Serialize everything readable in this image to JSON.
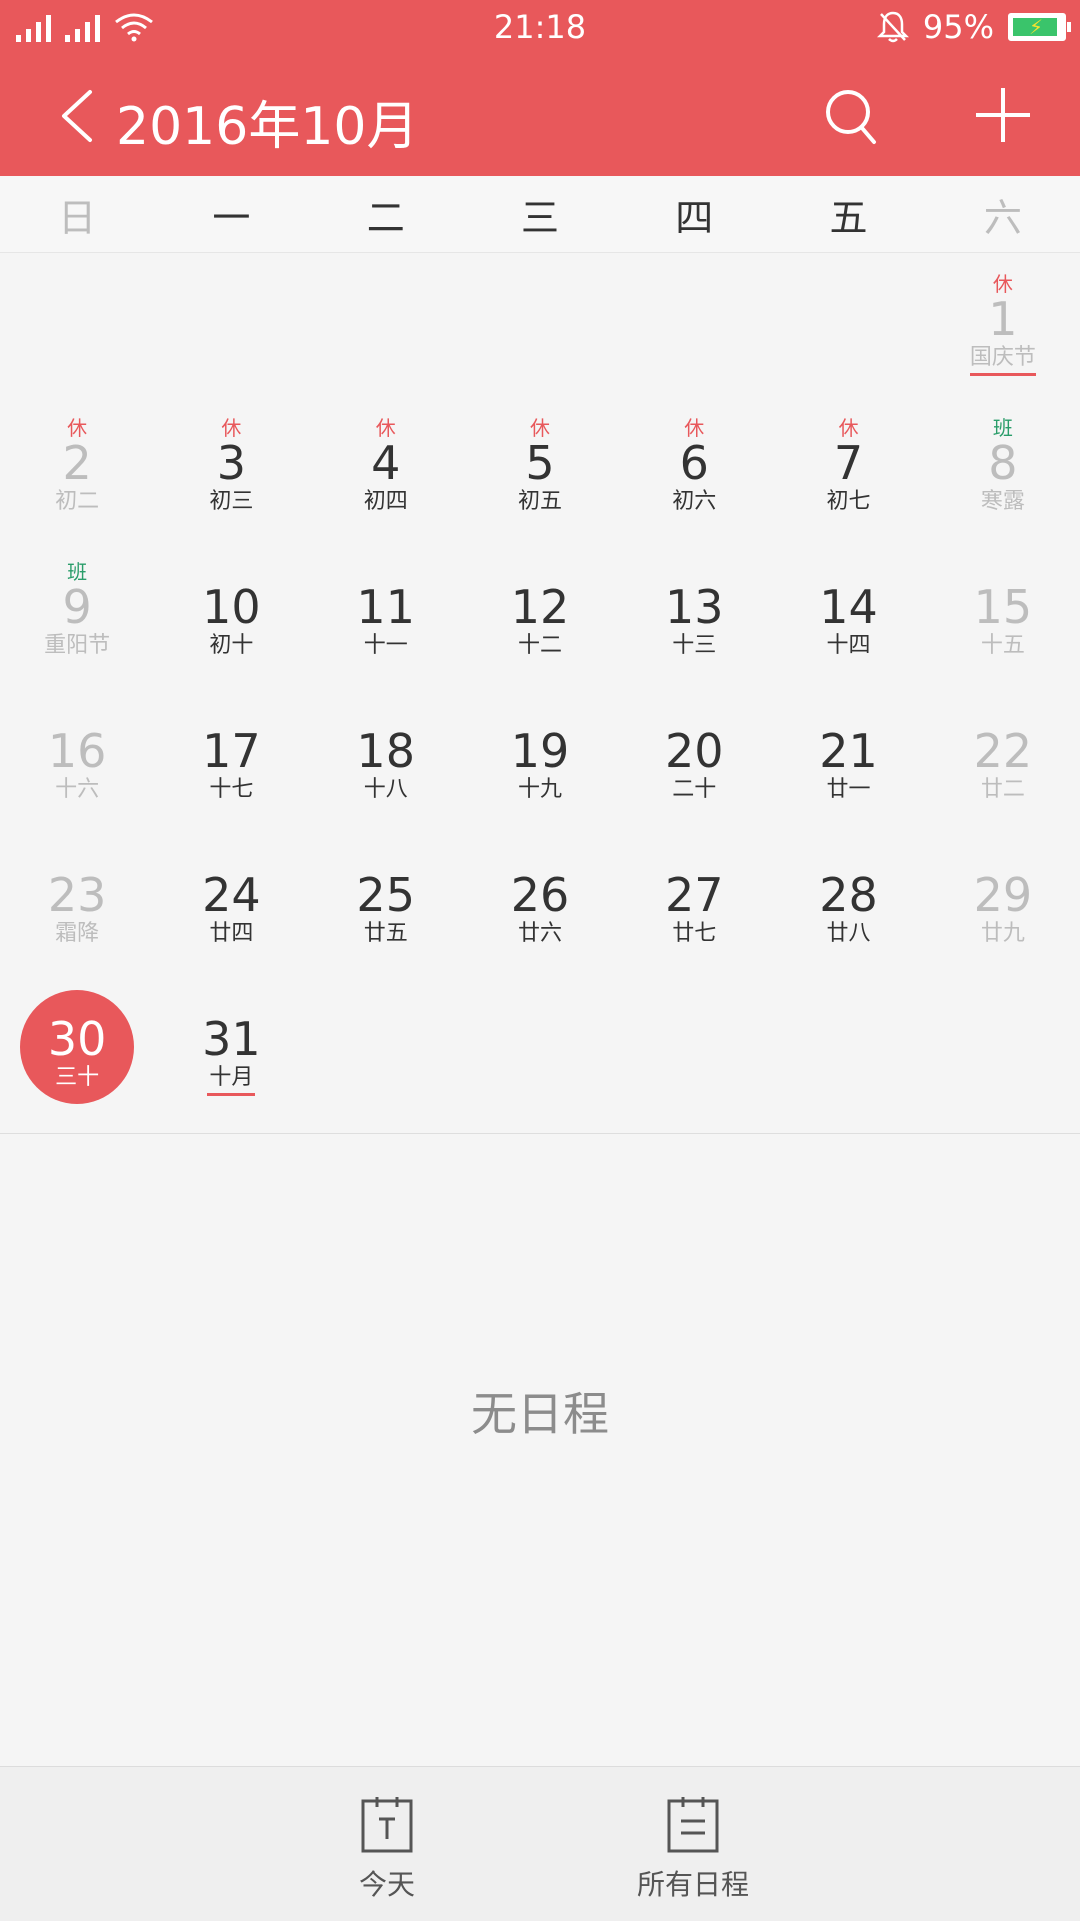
{
  "status_bar": {
    "time": "21:18",
    "battery": "95%",
    "icons": [
      "signal-icon",
      "signal-icon",
      "wifi-icon",
      "bell-off-icon",
      "battery-charging-icon"
    ]
  },
  "header": {
    "title": "2016年10月",
    "icons": [
      "back-icon",
      "search-icon",
      "add-icon"
    ]
  },
  "weekdays": [
    "日",
    "一",
    "二",
    "三",
    "四",
    "五",
    "六"
  ],
  "days": [
    {
      "num": "1",
      "lunar": "国庆节",
      "tag": "休"
    },
    {
      "num": "2",
      "lunar": "初二",
      "tag": "休"
    },
    {
      "num": "3",
      "lunar": "初三",
      "tag": "休"
    },
    {
      "num": "4",
      "lunar": "初四",
      "tag": "休"
    },
    {
      "num": "5",
      "lunar": "初五",
      "tag": "休"
    },
    {
      "num": "6",
      "lunar": "初六",
      "tag": "休"
    },
    {
      "num": "7",
      "lunar": "初七",
      "tag": "休"
    },
    {
      "num": "8",
      "lunar": "寒露",
      "tag": "班"
    },
    {
      "num": "9",
      "lunar": "重阳节",
      "tag": "班"
    },
    {
      "num": "10",
      "lunar": "初十"
    },
    {
      "num": "11",
      "lunar": "十一"
    },
    {
      "num": "12",
      "lunar": "十二"
    },
    {
      "num": "13",
      "lunar": "十三"
    },
    {
      "num": "14",
      "lunar": "十四"
    },
    {
      "num": "15",
      "lunar": "十五"
    },
    {
      "num": "16",
      "lunar": "十六"
    },
    {
      "num": "17",
      "lunar": "十七"
    },
    {
      "num": "18",
      "lunar": "十八"
    },
    {
      "num": "19",
      "lunar": "十九"
    },
    {
      "num": "20",
      "lunar": "二十"
    },
    {
      "num": "21",
      "lunar": "廿一"
    },
    {
      "num": "22",
      "lunar": "廿二"
    },
    {
      "num": "23",
      "lunar": "霜降"
    },
    {
      "num": "24",
      "lunar": "廿四"
    },
    {
      "num": "25",
      "lunar": "廿五"
    },
    {
      "num": "26",
      "lunar": "廿六"
    },
    {
      "num": "27",
      "lunar": "廿七"
    },
    {
      "num": "28",
      "lunar": "廿八"
    },
    {
      "num": "29",
      "lunar": "廿九"
    },
    {
      "num": "30",
      "lunar": "三十"
    },
    {
      "num": "31",
      "lunar": "十月"
    }
  ],
  "empty_message": "无日程",
  "bottom_tabs": {
    "today": {
      "label": "今天",
      "icon": "today-icon"
    },
    "all": {
      "label": "所有日程",
      "icon": "all-events-icon"
    }
  },
  "colors": {
    "accent": "#e8585b",
    "work_tag": "#2a9d6a",
    "muted": "#bdbdbd"
  }
}
